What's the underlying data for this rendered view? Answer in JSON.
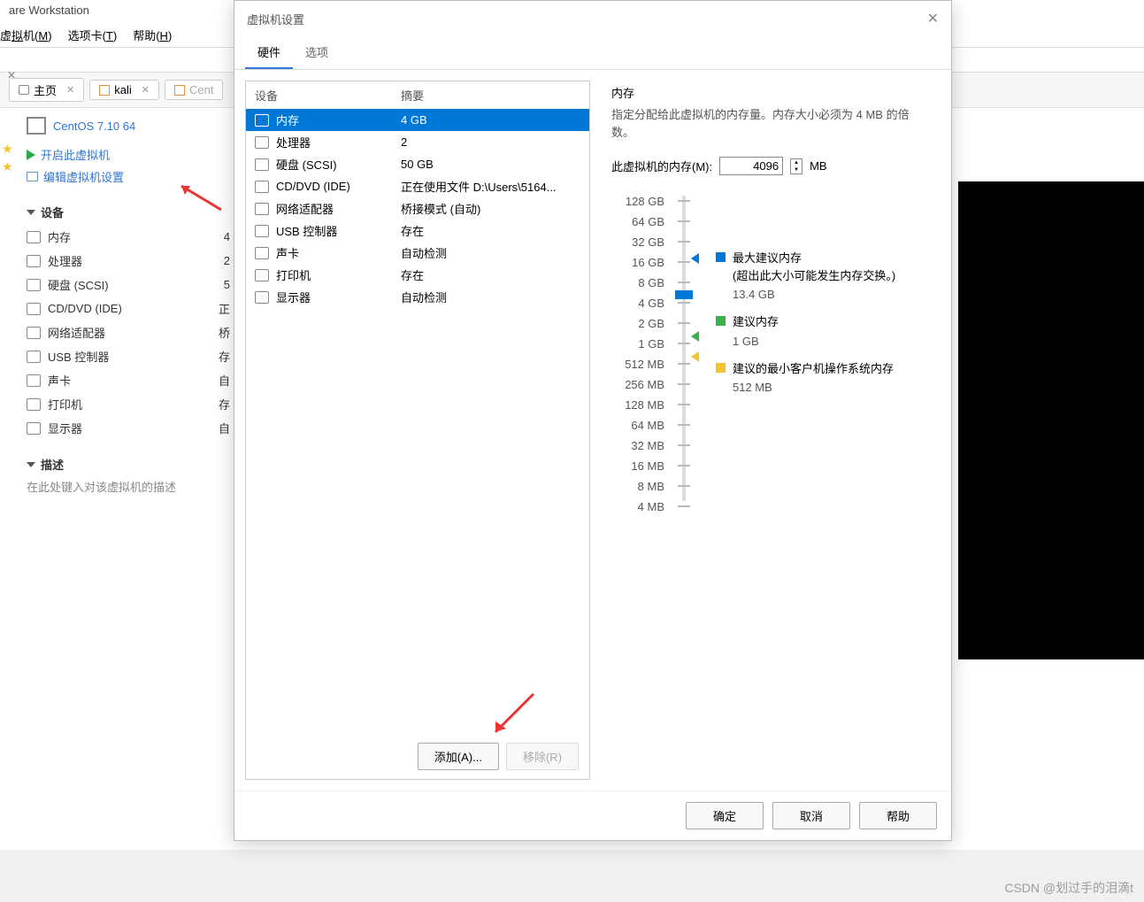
{
  "app": {
    "title": "are Workstation"
  },
  "menu": {
    "vm": "虚拟机(M)",
    "tabs": "选项卡(T)",
    "help": "帮助(H)"
  },
  "tabs": {
    "home": "主页",
    "kali": "kali",
    "cent": "Cent",
    "current_vm": "CentOS 7.10 64"
  },
  "actions": {
    "power_on": "开启此虚拟机",
    "edit_settings": "编辑虚拟机设置"
  },
  "sections": {
    "devices": "设备",
    "description": "描述"
  },
  "sidebar_devices": [
    {
      "name": "内存",
      "val": "4"
    },
    {
      "name": "处理器",
      "val": "2"
    },
    {
      "name": "硬盘 (SCSI)",
      "val": "5"
    },
    {
      "name": "CD/DVD (IDE)",
      "val": "正"
    },
    {
      "name": "网络适配器",
      "val": "桥"
    },
    {
      "name": "USB 控制器",
      "val": "存"
    },
    {
      "name": "声卡",
      "val": "自"
    },
    {
      "name": "打印机",
      "val": "存"
    },
    {
      "name": "显示器",
      "val": "自"
    }
  ],
  "desc_placeholder": "在此处键入对该虚拟机的描述",
  "modal": {
    "title": "虚拟机设置",
    "tab_hw": "硬件",
    "tab_opt": "选项",
    "col_device": "设备",
    "col_summary": "摘要",
    "btn_add": "添加(A)...",
    "btn_remove": "移除(R)",
    "btn_ok": "确定",
    "btn_cancel": "取消",
    "btn_help": "帮助"
  },
  "devices": [
    {
      "name": "内存",
      "summary": "4 GB",
      "sel": true
    },
    {
      "name": "处理器",
      "summary": "2"
    },
    {
      "name": "硬盘 (SCSI)",
      "summary": "50 GB"
    },
    {
      "name": "CD/DVD (IDE)",
      "summary": "正在使用文件 D:\\Users\\5164..."
    },
    {
      "name": "网络适配器",
      "summary": "桥接模式 (自动)"
    },
    {
      "name": "USB 控制器",
      "summary": "存在"
    },
    {
      "name": "声卡",
      "summary": "自动检测"
    },
    {
      "name": "打印机",
      "summary": "存在"
    },
    {
      "name": "显示器",
      "summary": "自动检测"
    }
  ],
  "memory": {
    "heading": "内存",
    "hint": "指定分配给此虚拟机的内存量。内存大小必须为 4 MB 的倍数。",
    "label": "此虚拟机的内存(M):",
    "value": "4096",
    "unit": "MB",
    "ticks": [
      "128 GB",
      "64 GB",
      "32 GB",
      "16 GB",
      "8 GB",
      "4 GB",
      "2 GB",
      "1 GB",
      "512 MB",
      "256 MB",
      "128 MB",
      "64 MB",
      "32 MB",
      "16 MB",
      "8 MB",
      "4 MB"
    ],
    "legend": {
      "max_label": "最大建议内存",
      "max_note": "(超出此大小可能发生内存交换。)",
      "max_val": "13.4 GB",
      "rec_label": "建议内存",
      "rec_val": "1 GB",
      "min_label": "建议的最小客户机操作系统内存",
      "min_val": "512 MB"
    }
  },
  "watermark": "CSDN @划过手的泪滴t"
}
